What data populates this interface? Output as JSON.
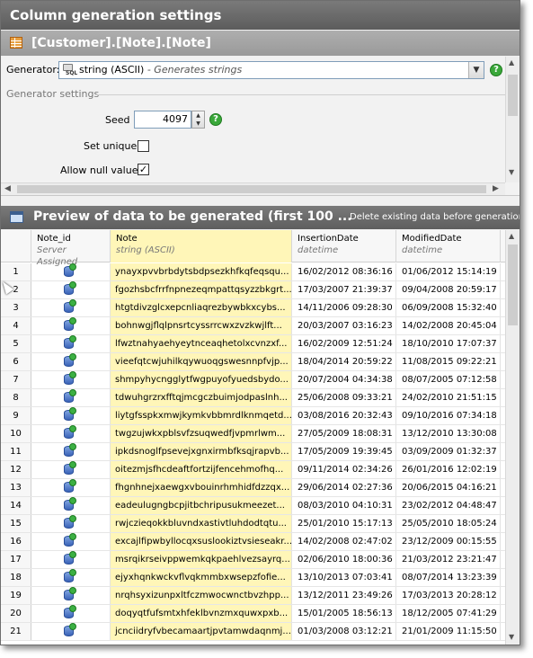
{
  "window": {
    "title": "Column generation settings"
  },
  "path": {
    "label": "[Customer].[Note].[Note]"
  },
  "generator": {
    "label": "Generator:",
    "value": "string (ASCII)",
    "description": " - Generates strings",
    "icon": "sql-string-icon"
  },
  "generator_settings": {
    "header": "Generator settings",
    "seed_label": "Seed",
    "seed_value": "4097",
    "set_unique_label": "Set unique",
    "set_unique_checked": false,
    "allow_null_label": "Allow null values",
    "allow_null_checked": true
  },
  "preview": {
    "title": "Preview of data to be generated (first 100 ...",
    "delete_label": "Delete existing data before generation"
  },
  "grid": {
    "columns": [
      {
        "name": "Note_id",
        "type": "Server Assigned"
      },
      {
        "name": "Note",
        "type": "string (ASCII)"
      },
      {
        "name": "InsertionDate",
        "type": "datetime"
      },
      {
        "name": "ModifiedDate",
        "type": "datetime"
      }
    ],
    "rows": [
      {
        "n": "1",
        "note": "ynayxpvvbrbdytsbdpsezkhfkqfeqsqu...",
        "ins": "16/02/2012 08:36:16",
        "mod": "01/06/2012 15:14:19"
      },
      {
        "n": "2",
        "note": "fgozhsbcfrrfnpnezeqmpattqsyzzbkgrt...",
        "ins": "17/03/2007 21:39:37",
        "mod": "09/04/2008 20:59:17"
      },
      {
        "n": "3",
        "note": "htgtdivzglcxepcnliaqrezbywbkxcybs...",
        "ins": "14/11/2006 09:28:30",
        "mod": "06/09/2008 15:32:40"
      },
      {
        "n": "4",
        "note": "bohnwgjflqlpnsrtcyssrrcwxzvzkwjlft...",
        "ins": "20/03/2007 03:16:23",
        "mod": "14/02/2008 20:45:04"
      },
      {
        "n": "5",
        "note": "lfwztnahyaehyeytnceaqhetolxcvnzxf...",
        "ins": "16/02/2009 12:51:24",
        "mod": "18/10/2010 17:07:37"
      },
      {
        "n": "6",
        "note": "vieefqtcwjuhilkqywuoqgswesnnpfvjp...",
        "ins": "18/04/2014 20:59:22",
        "mod": "11/08/2015 09:22:21"
      },
      {
        "n": "7",
        "note": "shmpyhycngglytfwgpuyofyuedsbydo...",
        "ins": "20/07/2004 04:34:38",
        "mod": "08/07/2005 07:12:58"
      },
      {
        "n": "8",
        "note": "tdwuhgrzrxfftqjmcgczbuimjodpaslnh...",
        "ins": "25/06/2008 09:33:21",
        "mod": "24/02/2010 21:51:15"
      },
      {
        "n": "9",
        "note": "liytgfsspkxmwjkymkvbbmrdlknmqetd...",
        "ins": "03/08/2016 20:32:43",
        "mod": "09/10/2016 07:34:18"
      },
      {
        "n": "10",
        "note": "twgzujwkxpblsvfzsuqwedfjvpmrlwm...",
        "ins": "27/05/2009 18:08:31",
        "mod": "13/12/2010 13:30:08"
      },
      {
        "n": "11",
        "note": "ipkdsnoglfpsevejxgnxirmbfksqjrapvb...",
        "ins": "17/05/2009 19:39:45",
        "mod": "03/09/2009 01:32:37"
      },
      {
        "n": "12",
        "note": "oitezmjsfhcdeaftfortzijfencehmofhq...",
        "ins": "09/11/2014 02:34:26",
        "mod": "26/01/2016 12:02:19"
      },
      {
        "n": "13",
        "note": "fhgnhnejxaewgxvbouinrhmhidfdzzqx...",
        "ins": "29/06/2014 02:27:36",
        "mod": "20/06/2015 04:16:21"
      },
      {
        "n": "14",
        "note": "eadeulugngbcpjitbchripusukmeezet...",
        "ins": "08/03/2010 04:10:31",
        "mod": "23/02/2012 04:48:47"
      },
      {
        "n": "15",
        "note": "rwjczieqokkbluvndxastivtluhdodtqtu...",
        "ins": "25/01/2010 15:17:13",
        "mod": "25/05/2010 18:05:24"
      },
      {
        "n": "16",
        "note": "excajlfipwbyllocqxsuslookiztvsieseakr...",
        "ins": "14/02/2008 02:47:02",
        "mod": "23/12/2009 00:15:55"
      },
      {
        "n": "17",
        "note": "msrqikrseivppwemkqkpaehlvezsayrq...",
        "ins": "02/06/2010 18:00:36",
        "mod": "21/03/2012 23:21:47"
      },
      {
        "n": "18",
        "note": "ejyxhqnkwckvflvqkmmbxwsepzfofie...",
        "ins": "13/10/2013 07:03:41",
        "mod": "08/07/2014 13:23:39"
      },
      {
        "n": "19",
        "note": "nrqhsyxizunpxltfczmwocwnctbvzhpp...",
        "ins": "13/12/2011 23:49:26",
        "mod": "17/03/2013 20:28:12"
      },
      {
        "n": "20",
        "note": "doqyqtfufsmtxhfeklbvnzmxquwxpxb...",
        "ins": "15/01/2005 18:56:13",
        "mod": "18/12/2005 07:41:29"
      },
      {
        "n": "21",
        "note": "jcnciidryfvbecamaartjpvtamwdaqnmj...",
        "ins": "01/03/2008 03:12:21",
        "mod": "21/01/2009 11:15:50"
      }
    ]
  },
  "icons": {
    "row": "database-row-icon",
    "help": "help-icon",
    "table": "table-icon",
    "preview": "preview-grid-icon"
  },
  "colors": {
    "title_bar": "#6a6a6a",
    "path_bar": "#a4a4a4",
    "note_column": "#fff6b8",
    "help": "#3aa83a"
  }
}
